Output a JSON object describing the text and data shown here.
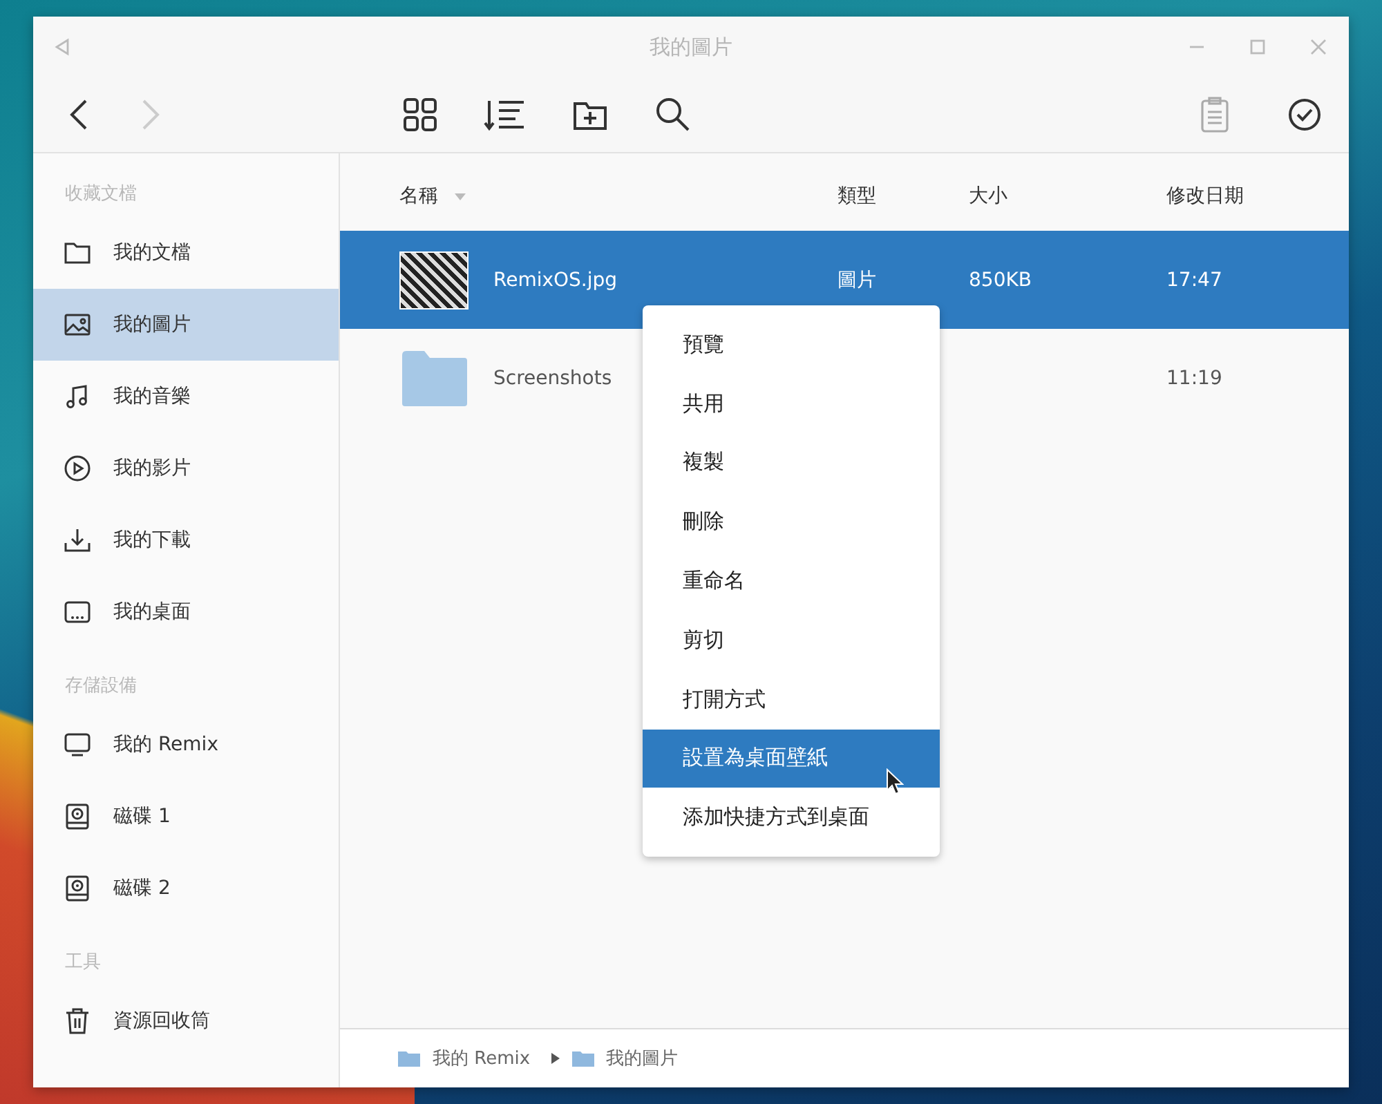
{
  "window": {
    "title": "我的圖片"
  },
  "sidebar": {
    "sections": [
      {
        "heading": "收藏文檔",
        "items": [
          {
            "label": "我的文檔",
            "kind": "folder",
            "selected": false
          },
          {
            "label": "我的圖片",
            "kind": "image",
            "selected": true
          },
          {
            "label": "我的音樂",
            "kind": "music",
            "selected": false
          },
          {
            "label": "我的影片",
            "kind": "video",
            "selected": false
          },
          {
            "label": "我的下載",
            "kind": "download",
            "selected": false
          },
          {
            "label": "我的桌面",
            "kind": "desktop",
            "selected": false
          }
        ]
      },
      {
        "heading": "存儲設備",
        "items": [
          {
            "label": "我的 Remix",
            "kind": "monitor",
            "selected": false
          },
          {
            "label": "磁碟 1",
            "kind": "disk",
            "selected": false
          },
          {
            "label": "磁碟 2",
            "kind": "disk",
            "selected": false
          }
        ]
      },
      {
        "heading": "工具",
        "items": [
          {
            "label": "資源回收筒",
            "kind": "trash",
            "selected": false
          }
        ]
      }
    ]
  },
  "table": {
    "columns": [
      "名稱",
      "類型",
      "大小",
      "修改日期"
    ],
    "rows": [
      {
        "kind": "image",
        "name": "RemixOS.jpg",
        "type": "圖片",
        "size": "850KB",
        "modified": "17:47",
        "selected": true
      },
      {
        "kind": "folder",
        "name": "Screenshots",
        "type": "",
        "size": "",
        "modified": "11:19",
        "selected": false
      }
    ]
  },
  "context_menu": {
    "items": [
      {
        "label": "預覽",
        "selected": false
      },
      {
        "label": "共用",
        "selected": false
      },
      {
        "label": "複製",
        "selected": false
      },
      {
        "label": "刪除",
        "selected": false
      },
      {
        "label": "重命名",
        "selected": false
      },
      {
        "label": "剪切",
        "selected": false
      },
      {
        "label": "打開方式",
        "selected": false
      },
      {
        "label": "設置為桌面壁紙",
        "selected": true
      },
      {
        "label": "添加快捷方式到桌面",
        "selected": false
      }
    ]
  },
  "breadcrumb": [
    "我的 Remix",
    "我的圖片"
  ]
}
